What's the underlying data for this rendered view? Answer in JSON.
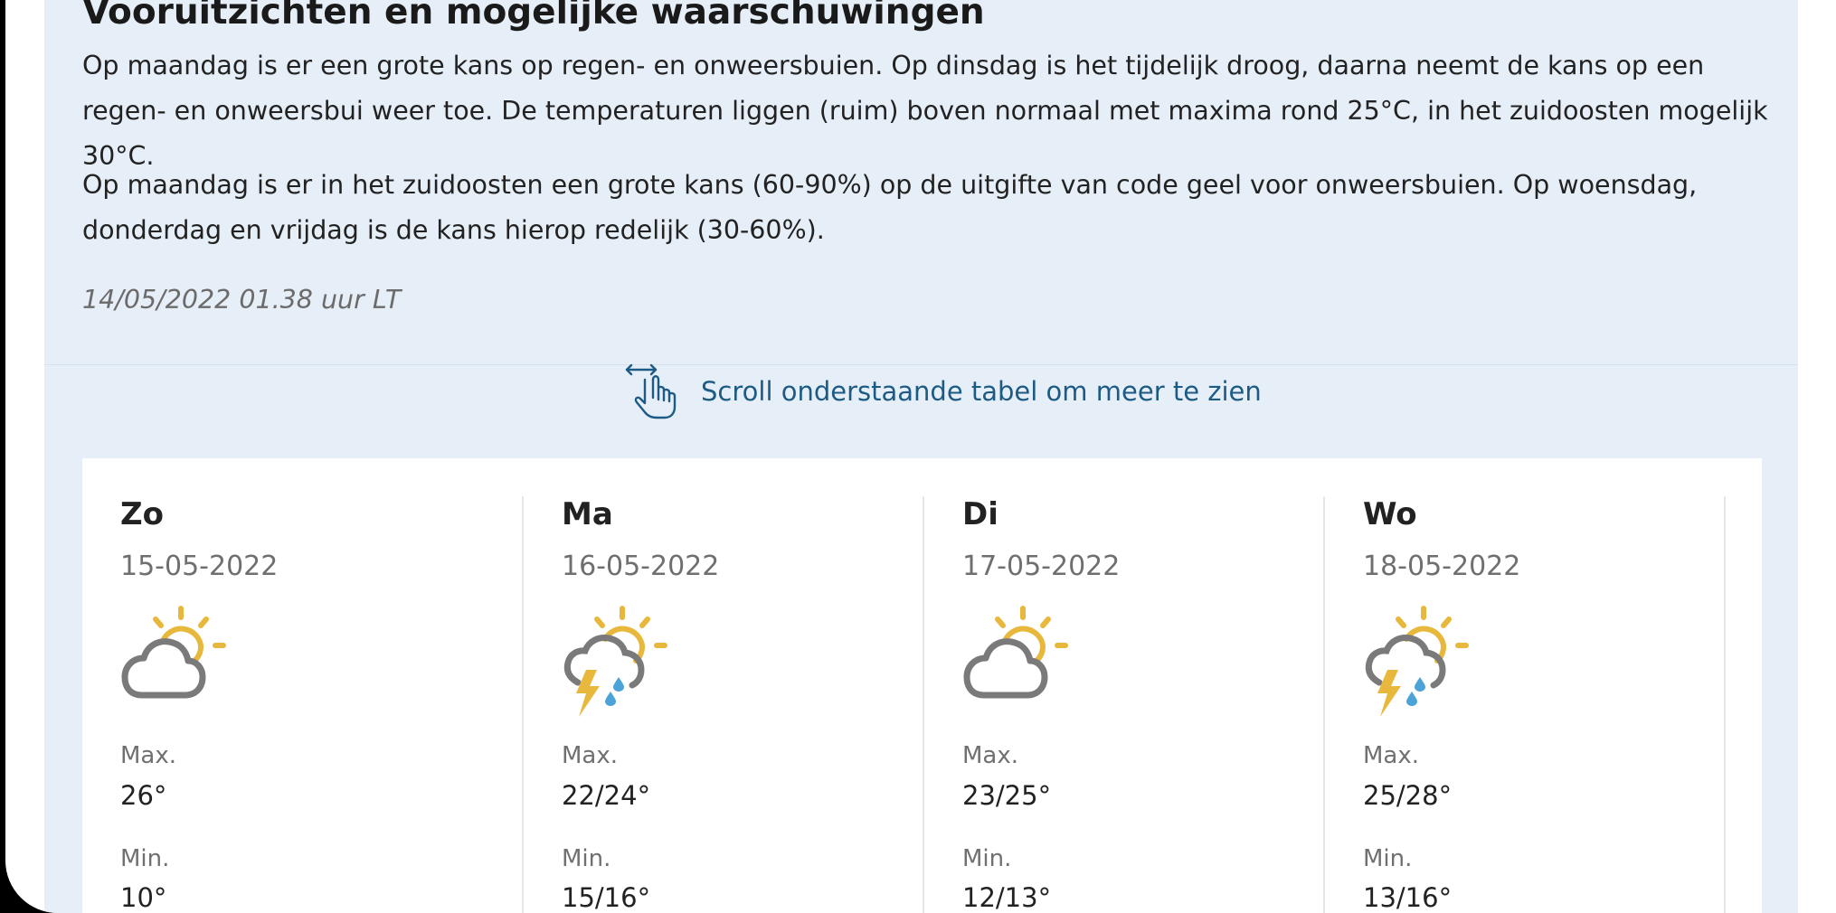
{
  "outlook": {
    "heading": "Vooruitzichten en mogelijke waarschuwingen",
    "paragraph_1": "Op maandag is er een grote kans op regen- en onweersbuien. Op dinsdag is het tijdelijk droog, daarna neemt de kans op een regen- en onweersbui weer toe. De temperaturen liggen (ruim) boven normaal met maxima rond 25°C, in het zuidoosten mogelijk 30°C.",
    "paragraph_2": "Op maandag is er in het zuidoosten een grote kans (60-90%) op de uitgifte van code geel voor onweersbuien. Op woensdag, donderdag en vrijdag is de kans hierop redelijk (30-60%).",
    "timestamp": "14/05/2022 01.38 uur LT"
  },
  "scroll_hint": {
    "text": "Scroll onderstaande tabel om meer te zien",
    "icon": "scroll-hand-icon"
  },
  "colors": {
    "panel_background": "#e6eef8",
    "link_blue": "#1d5b85",
    "sun_yellow": "#e8b83c",
    "cloud_grey": "#7a7a7a",
    "rain_blue": "#4ba3d8"
  },
  "forecast": {
    "max_label": "Max.",
    "min_label": "Min.",
    "days": [
      {
        "day": "Zo",
        "date": "15-05-2022",
        "icon": "sun-behind-cloud-icon",
        "max": "26°",
        "min": "10°"
      },
      {
        "day": "Ma",
        "date": "16-05-2022",
        "icon": "thunder-rain-sun-cloud-icon",
        "max": "22/24°",
        "min": "15/16°"
      },
      {
        "day": "Di",
        "date": "17-05-2022",
        "icon": "sun-behind-cloud-icon",
        "max": "23/25°",
        "min": "12/13°"
      },
      {
        "day": "Wo",
        "date": "18-05-2022",
        "icon": "thunder-rain-sun-cloud-icon",
        "max": "25/28°",
        "min": "13/16°"
      }
    ]
  }
}
